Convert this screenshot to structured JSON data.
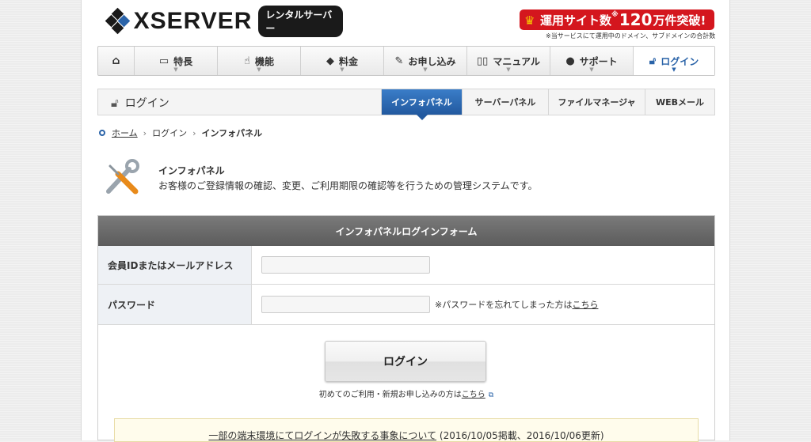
{
  "header": {
    "logo_text": "XSERVER",
    "logo_badge": "レンタルサーバー",
    "promo": {
      "prefix": "運用サイト数",
      "mark": "※",
      "number": "120",
      "suffix": "万件突破!"
    },
    "promo_note": "※当サービスにて運用中のドメイン、サブドメインの合計数"
  },
  "nav": [
    {
      "icon": "home-icon",
      "label": ""
    },
    {
      "icon": "monitor-icon",
      "label": "特長"
    },
    {
      "icon": "cursor-icon",
      "label": "機能"
    },
    {
      "icon": "tag-icon",
      "label": "料金"
    },
    {
      "icon": "pencil-icon",
      "label": "お申し込み"
    },
    {
      "icon": "book-icon",
      "label": "マニュアル"
    },
    {
      "icon": "user-icon",
      "label": "サポート"
    },
    {
      "icon": "unlock-icon",
      "label": "ログイン"
    }
  ],
  "subbar": {
    "title": "ログイン",
    "tabs": [
      "インフォパネル",
      "サーバーパネル",
      "ファイルマネージャ",
      "WEBメール"
    ],
    "active_tab": "インフォパネル"
  },
  "breadcrumb": {
    "home": "ホーム",
    "login": "ログイン",
    "current": "インフォパネル"
  },
  "intro": {
    "title": "インフォパネル",
    "description": "お客様のご登録情報の確認、変更、ご利用期限の確認等を行うための管理システムです。"
  },
  "form": {
    "header": "インフォパネルログインフォーム",
    "id_label": "会員IDまたはメールアドレス",
    "id_value": "",
    "password_label": "パスワード",
    "password_value": "",
    "forgot_text": "※パスワードを忘れてしまった方は",
    "forgot_link": "こちら",
    "login_button": "ログイン",
    "first_text": "初めてのご利用・新規お申し込みの方は",
    "first_link": "こちら"
  },
  "notice": {
    "link": "一部の端末環境にてログインが失敗する事象について",
    "dates": "(2016/10/05掲載、2016/10/06更新)"
  },
  "colors": {
    "accent_blue": "#2a63a8",
    "promo_red": "#d4161e",
    "form_header": "#666666"
  }
}
